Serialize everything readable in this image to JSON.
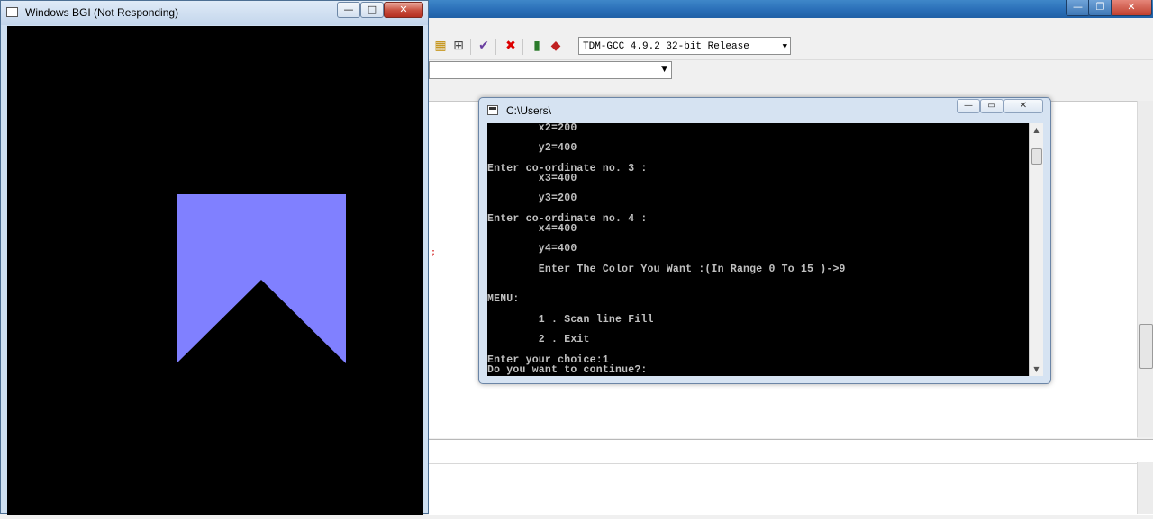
{
  "ide": {
    "compiler": "TDM-GCC 4.9.2 32-bit Release",
    "window_buttons": [
      "—",
      "❐",
      "✕"
    ]
  },
  "bgi": {
    "title": "Windows BGI (Not Responding)",
    "buttons": [
      "—",
      "□",
      "✕"
    ],
    "shape_color": "#8080ff"
  },
  "console": {
    "title": "C:\\Users\\",
    "buttons": [
      "—",
      "▭",
      "✕"
    ],
    "lines": [
      "        x2=200",
      "",
      "        y2=400",
      "",
      "Enter co-ordinate no. 3 :",
      "        x3=400",
      "",
      "        y3=200",
      "",
      "Enter co-ordinate no. 4 :",
      "        x4=400",
      "",
      "        y4=400",
      "",
      "        Enter The Color You Want :(In Range 0 To 15 )->9",
      "",
      "",
      "MENU:",
      "",
      "        1 . Scan line Fill",
      "",
      "        2 . Exit",
      "",
      "Enter your choice:1",
      "Do you want to continue?:"
    ]
  }
}
